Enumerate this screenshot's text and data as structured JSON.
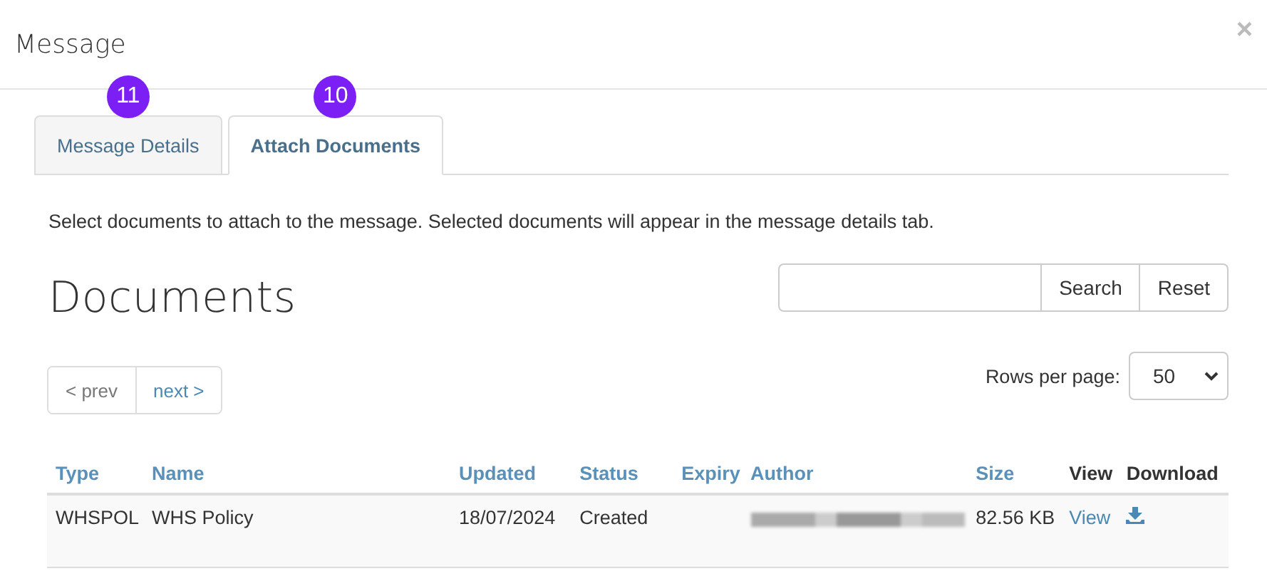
{
  "window": {
    "title": "Message",
    "close": "×"
  },
  "tabs": [
    {
      "label": "Message Details",
      "selected": false,
      "badge": "11"
    },
    {
      "label": "Attach Documents",
      "selected": true,
      "badge": "10"
    }
  ],
  "description": "Select documents to attach to the message. Selected documents will appear in the message details tab.",
  "heading": "Documents",
  "search": {
    "buttons": [
      "Search",
      "Reset"
    ]
  },
  "pager": [
    {
      "label": "< prev",
      "disabled": true
    },
    {
      "label": "next >",
      "disabled": false
    }
  ],
  "rows_per_page": {
    "label": "Rows per page:",
    "value": "50"
  },
  "table": {
    "columns": [
      {
        "label": "Type",
        "sortable": true
      },
      {
        "label": "Name",
        "sortable": true
      },
      {
        "label": "Updated",
        "sortable": true
      },
      {
        "label": "Status",
        "sortable": true
      },
      {
        "label": "Expiry",
        "sortable": true
      },
      {
        "label": "Author",
        "sortable": true
      },
      {
        "label": "Size",
        "sortable": true
      },
      {
        "label": "View",
        "sortable": false
      },
      {
        "label": "Download",
        "sortable": false
      }
    ],
    "rows": [
      {
        "type": "WHSPOL",
        "name": "WHS Policy",
        "updated": "18/07/2024",
        "status": "Created",
        "author_redacted": true,
        "size": "82.56 KB",
        "view": "View"
      }
    ]
  }
}
